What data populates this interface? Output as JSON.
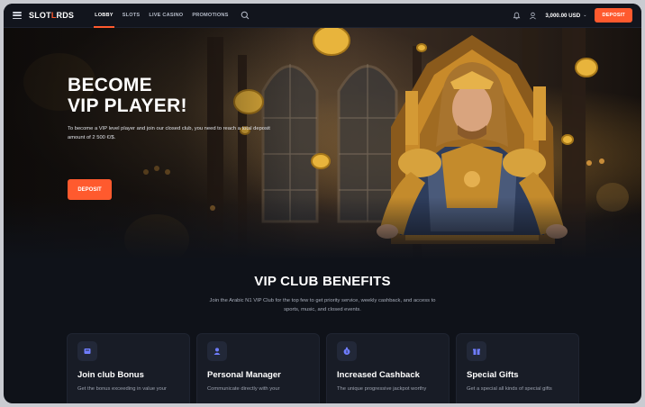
{
  "header": {
    "logo_part1": "SLOT",
    "logo_part2": "L",
    "logo_part3": "RDS",
    "nav": [
      "LOBBY",
      "SLOTS",
      "LIVE CASINO",
      "PROMOTIONS"
    ],
    "balance": "3,000.00 USD",
    "deposit_label": "DEPOSIT"
  },
  "hero": {
    "title_line1": "BECOME",
    "title_line2": "VIP PLAYER!",
    "text": "To become a VIP level player and join our closed club, you need to reach a total deposit amount of 2 500 €/$.",
    "cta_label": "DEPOSIT"
  },
  "benefits": {
    "title": "VIP CLUB BENEFITS",
    "subtitle": "Join the Arabic N1 VIP Club for the top few to get priority service, weekly cashback, and access to sports, music, and closed events.",
    "cards": [
      {
        "icon": "bonus-icon",
        "title": "Join club Bonus",
        "desc": "Get the bonus exceeding in value your"
      },
      {
        "icon": "user-icon",
        "title": "Personal Manager",
        "desc": "Communicate directly with your"
      },
      {
        "icon": "cashback-icon",
        "title": "Increased Cashback",
        "desc": "The unique progressive jackpot worthy"
      },
      {
        "icon": "gift-icon",
        "title": "Special Gifts",
        "desc": "Get a special all kinds of special gifts"
      }
    ]
  },
  "colors": {
    "accent": "#ff5a2e",
    "background": "#0f1219",
    "card": "#181c26",
    "icon_tint": "#6f7dff"
  }
}
